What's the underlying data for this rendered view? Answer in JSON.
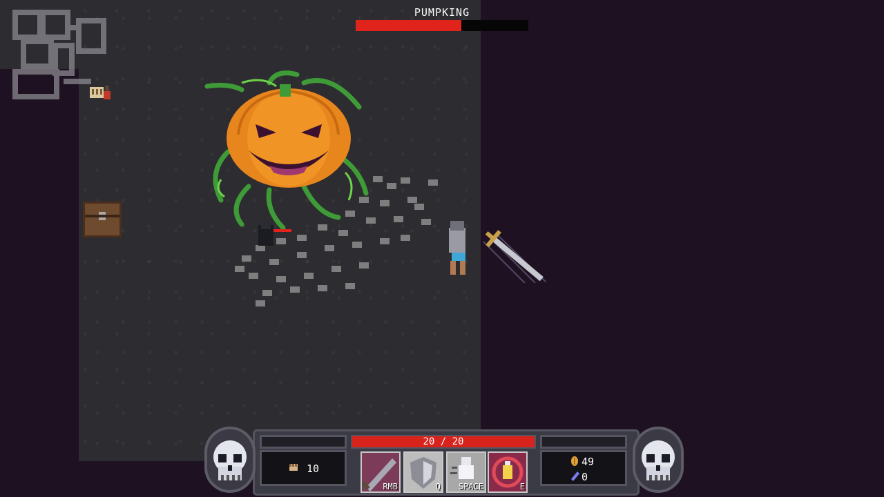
{
  "boss": {
    "name": "PUMPKING",
    "health_fraction": 0.61,
    "bar_color": "#e0231b"
  },
  "player": {
    "hp_text": "20 / 20",
    "hp_fraction": 1.0
  },
  "hud": {
    "keys_count": "10",
    "gold_count": "49",
    "gem_count": "0",
    "abilities": [
      {
        "key_label": "RMB",
        "icon": "sword-slash-icon"
      },
      {
        "key_label": "Q",
        "icon": "shield-icon"
      },
      {
        "key_label": "SPACE",
        "icon": "dash-icon"
      },
      {
        "key_label": "E",
        "icon": "potion-icon"
      }
    ]
  },
  "colors": {
    "room_floor": "#2d2c31",
    "void": "#1e1222",
    "hp_red": "#d8231d"
  }
}
